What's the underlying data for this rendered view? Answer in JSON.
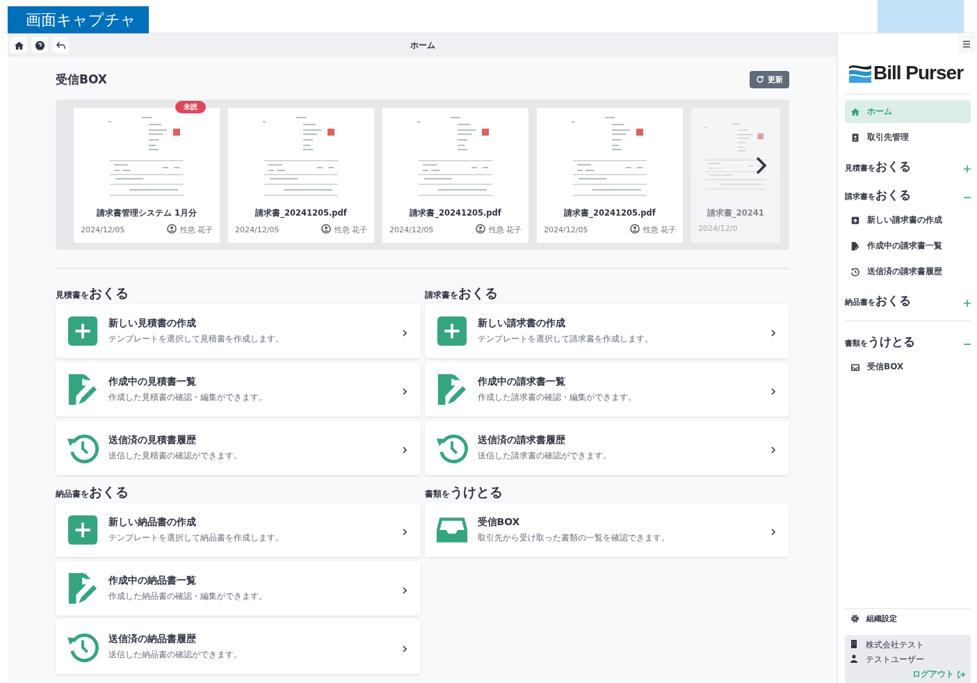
{
  "caption": "画面キャプチャ",
  "toolbar": {
    "title": "ホーム"
  },
  "inbox": {
    "title": "受信BOX",
    "refresh_label": "更新",
    "documents": [
      {
        "title": "請求書管理システム 1月分",
        "date": "2024/12/05",
        "user": "性急 花子",
        "unread": true,
        "badge": "未読"
      },
      {
        "title": "請求書_20241205.pdf",
        "date": "2024/12/05",
        "user": "性急 花子",
        "unread": false
      },
      {
        "title": "請求書_20241205.pdf",
        "date": "2024/12/05",
        "user": "性急 花子",
        "unread": false
      },
      {
        "title": "請求書_20241205.pdf",
        "date": "2024/12/05",
        "user": "性急 花子",
        "unread": false
      },
      {
        "title": "請求書_20241",
        "date": "2024/12/0",
        "unread": false
      }
    ]
  },
  "sections": [
    {
      "prefix": "見積書を",
      "title": "おくる",
      "cards": [
        {
          "kind": "new",
          "title": "新しい見積書の作成",
          "description": "テンプレートを選択して見積書を作成します。"
        },
        {
          "kind": "draft",
          "title": "作成中の見積書一覧",
          "description": "作成した見積書の確認・編集ができます。"
        },
        {
          "kind": "history",
          "title": "送信済の見積書履歴",
          "description": "送信した見積書の確認ができます。"
        }
      ]
    },
    {
      "prefix": "請求書を",
      "title": "おくる",
      "cards": [
        {
          "kind": "new",
          "title": "新しい請求書の作成",
          "description": "テンプレートを選択して請求書を作成します。"
        },
        {
          "kind": "draft",
          "title": "作成中の請求書一覧",
          "description": "作成した請求書の確認・編集ができます。"
        },
        {
          "kind": "history",
          "title": "送信済の請求書履歴",
          "description": "送信した請求書の確認ができます。"
        }
      ]
    },
    {
      "prefix": "納品書を",
      "title": "おくる",
      "cards": [
        {
          "kind": "new",
          "title": "新しい納品書の作成",
          "description": "テンプレートを選択して納品書を作成します。"
        },
        {
          "kind": "draft",
          "title": "作成中の納品書一覧",
          "description": "作成した納品書の確認・編集ができます。"
        },
        {
          "kind": "history",
          "title": "送信済の納品書履歴",
          "description": "送信した納品書の確認ができます。"
        }
      ]
    },
    {
      "prefix": "書類を",
      "title": "うけとる",
      "cards": [
        {
          "kind": "inbox",
          "title": "受信BOX",
          "description": "取引先から受け取った書類の一覧を確認できます。"
        }
      ]
    }
  ],
  "sidebar": {
    "logo": "Bill Purser",
    "groups": [
      {
        "items": [
          {
            "kind": "home",
            "label": "ホーム",
            "selected": true
          },
          {
            "kind": "contacts",
            "label": "取引先管理",
            "selected": false
          },
          {
            "kind": "heading",
            "prefix": "見積書を",
            "title": "おくる",
            "expanded": false
          },
          {
            "kind": "heading",
            "prefix": "請求書を",
            "title": "おくる",
            "expanded": true,
            "children": [
              {
                "kind": "new",
                "label": "新しい請求書の作成",
                "selected": false
              },
              {
                "kind": "draft",
                "label": "作成中の請求書一覧",
                "selected": false
              },
              {
                "kind": "history",
                "label": "送信済の請求書履歴",
                "selected": false
              }
            ]
          },
          {
            "kind": "heading",
            "prefix": "納品書を",
            "title": "おくる",
            "expanded": false
          }
        ]
      },
      {
        "items": [
          {
            "kind": "heading",
            "prefix": "書類を",
            "title": "うけとる",
            "expanded": true,
            "children": [
              {
                "kind": "inbox",
                "label": "受信BOX",
                "selected": false
              }
            ]
          }
        ]
      }
    ],
    "settings": "組織設定",
    "account": {
      "company": "株式会社テスト",
      "user": "テストユーザー",
      "logout": "ログアウト"
    }
  }
}
